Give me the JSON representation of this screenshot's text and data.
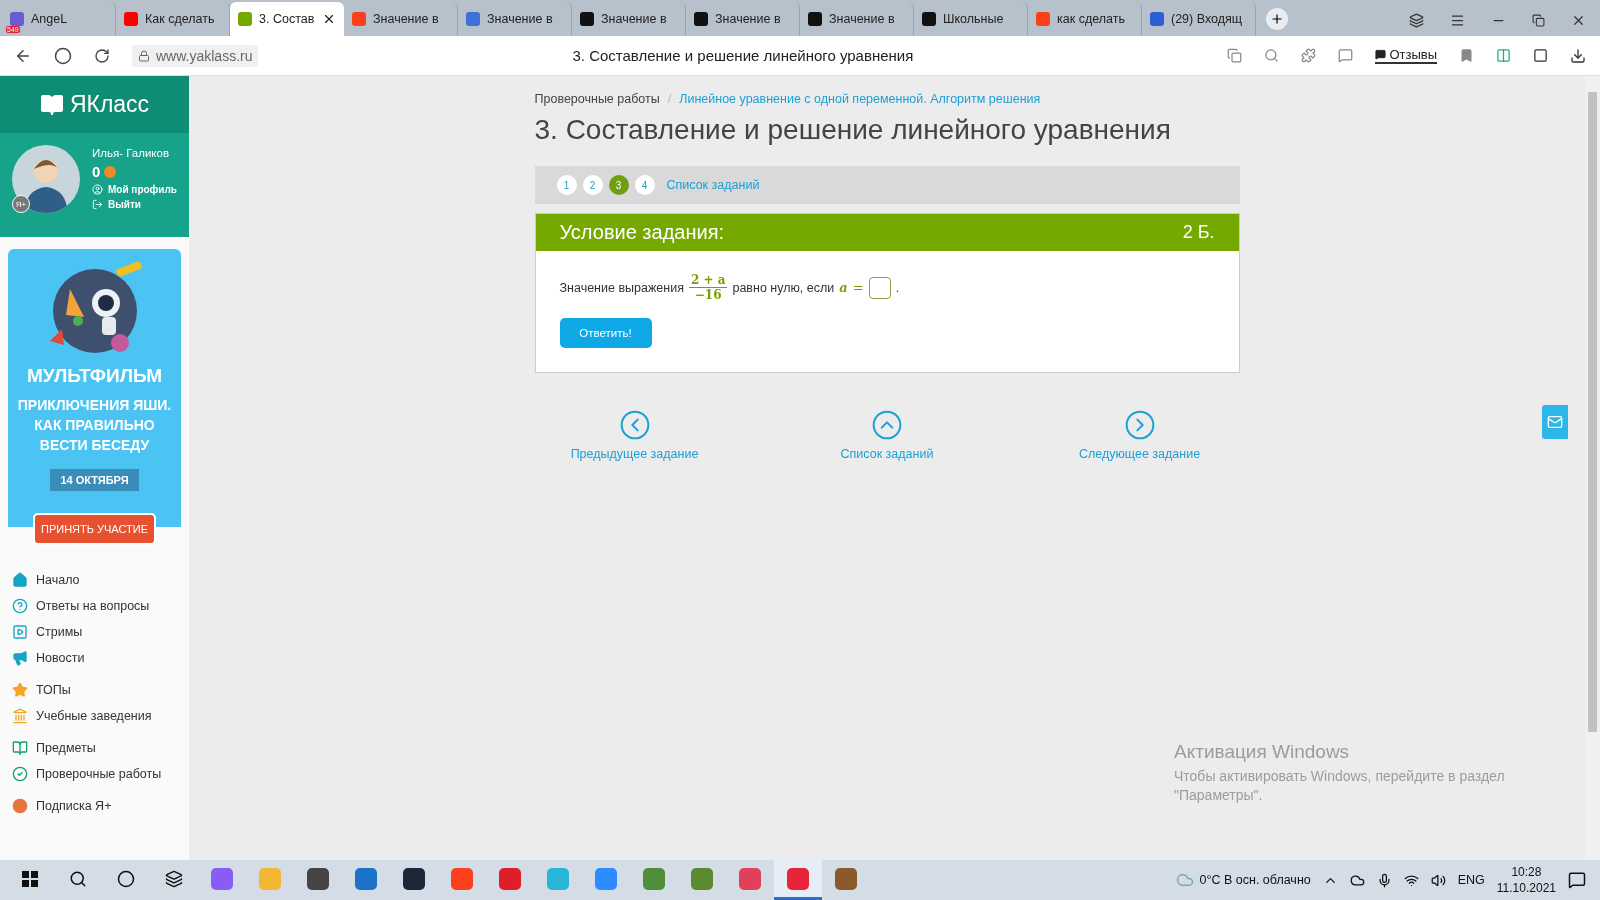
{
  "browser": {
    "tabs": [
      {
        "label": "AngeL",
        "selected": false,
        "color": "#6b5bd2",
        "badge": "549"
      },
      {
        "label": "Как сделать",
        "selected": false,
        "color": "#ff0000"
      },
      {
        "label": "3. Состав",
        "selected": true,
        "color": "#76a900"
      },
      {
        "label": "Значение в",
        "selected": false,
        "color": "#fc3f1d"
      },
      {
        "label": "Значение в",
        "selected": false,
        "color": "#3f6fd8"
      },
      {
        "label": "Значение в",
        "selected": false,
        "color": "#111111"
      },
      {
        "label": "Значение в",
        "selected": false,
        "color": "#111111"
      },
      {
        "label": "Значение в",
        "selected": false,
        "color": "#111111"
      },
      {
        "label": "Школьные",
        "selected": false,
        "color": "#111111"
      },
      {
        "label": "как сделать",
        "selected": false,
        "color": "#fc3f1d"
      },
      {
        "label": "(29) Входящ",
        "selected": false,
        "color": "#2a5fd6"
      }
    ],
    "url": "www.yaklass.ru",
    "page_title": "3. Составление и решение линейного уравнения",
    "feedback": "Отзывы"
  },
  "sidebar": {
    "logo": "ЯКласс",
    "profile": {
      "name": "Илья- Галиков",
      "score": "0",
      "badge": "Я+",
      "links": [
        {
          "label": "Мой профиль"
        },
        {
          "label": "Выйти"
        }
      ]
    },
    "promo": {
      "title": "МУЛЬТФИЛЬМ",
      "subtitle": "ПРИКЛЮЧЕНИЯ ЯШИ. КАК ПРАВИЛЬНО ВЕСТИ БЕСЕДУ",
      "date": "14 ОКТЯБРЯ",
      "button": "ПРИНЯТЬ УЧАСТИЕ"
    },
    "menu_groups": [
      [
        {
          "label": "Начало"
        },
        {
          "label": "Ответы на вопросы"
        },
        {
          "label": "Стримы"
        },
        {
          "label": "Новости"
        }
      ],
      [
        {
          "label": "ТОПы"
        },
        {
          "label": "Учебные заведения"
        }
      ],
      [
        {
          "label": "Предметы"
        },
        {
          "label": "Проверочные работы"
        }
      ],
      [
        {
          "label": "Подписка Я+"
        }
      ]
    ]
  },
  "breadcrumbs": {
    "separator": "/",
    "items": [
      {
        "label": "Проверочные работы",
        "link": false
      },
      {
        "label": "Линейное уравнение с одной переменной. Алгоритм решения",
        "link": true
      }
    ]
  },
  "title": "3. Составление и решение линейного уравнения",
  "task_steps": [
    {
      "label": "1",
      "selected": false
    },
    {
      "label": "2",
      "selected": false
    },
    {
      "label": "3",
      "selected": true
    },
    {
      "label": "4",
      "selected": false
    }
  ],
  "task_list_link": "Список заданий",
  "task": {
    "header": "Условие задания:",
    "points": "2 Б.",
    "statement": {
      "prefix": "Значение выражения",
      "numerator": "2 + a",
      "denominator": "−16",
      "middle": "равно нулю, если",
      "variable": "a",
      "relation": "=",
      "suffix": "."
    },
    "submit": "Ответить!"
  },
  "navigation": [
    {
      "label": "Предыдущее задание"
    },
    {
      "label": "Список заданий"
    },
    {
      "label": "Следующее задание"
    }
  ],
  "activation": {
    "title": "Активация Windows",
    "text": "Чтобы активировать Windows, перейдите в раздел \"Параметры\"."
  },
  "taskbar": {
    "apps": [
      {
        "color": "#8a5cf6",
        "selected": false
      },
      {
        "color": "#f2b632",
        "selected": false
      },
      {
        "color": "#444444",
        "selected": false
      },
      {
        "color": "#1a73c8",
        "selected": false
      },
      {
        "color": "#1b2838",
        "selected": false
      },
      {
        "color": "#fc3f1d",
        "selected": false
      },
      {
        "color": "#e01e2b",
        "selected": false
      },
      {
        "color": "#29b6d6",
        "selected": false
      },
      {
        "color": "#2d8cff",
        "selected": false
      },
      {
        "color": "#4f8f3a",
        "selected": false
      },
      {
        "color": "#5c8a2e",
        "selected": false
      },
      {
        "color": "#e0405a",
        "selected": false
      },
      {
        "color": "#e8243a",
        "selected": true
      },
      {
        "color": "#8a5a2b",
        "selected": false
      }
    ],
    "weather": "0°C  В осн. облачно",
    "language": "ENG",
    "time": "10:28",
    "date": "11.10.2021"
  }
}
